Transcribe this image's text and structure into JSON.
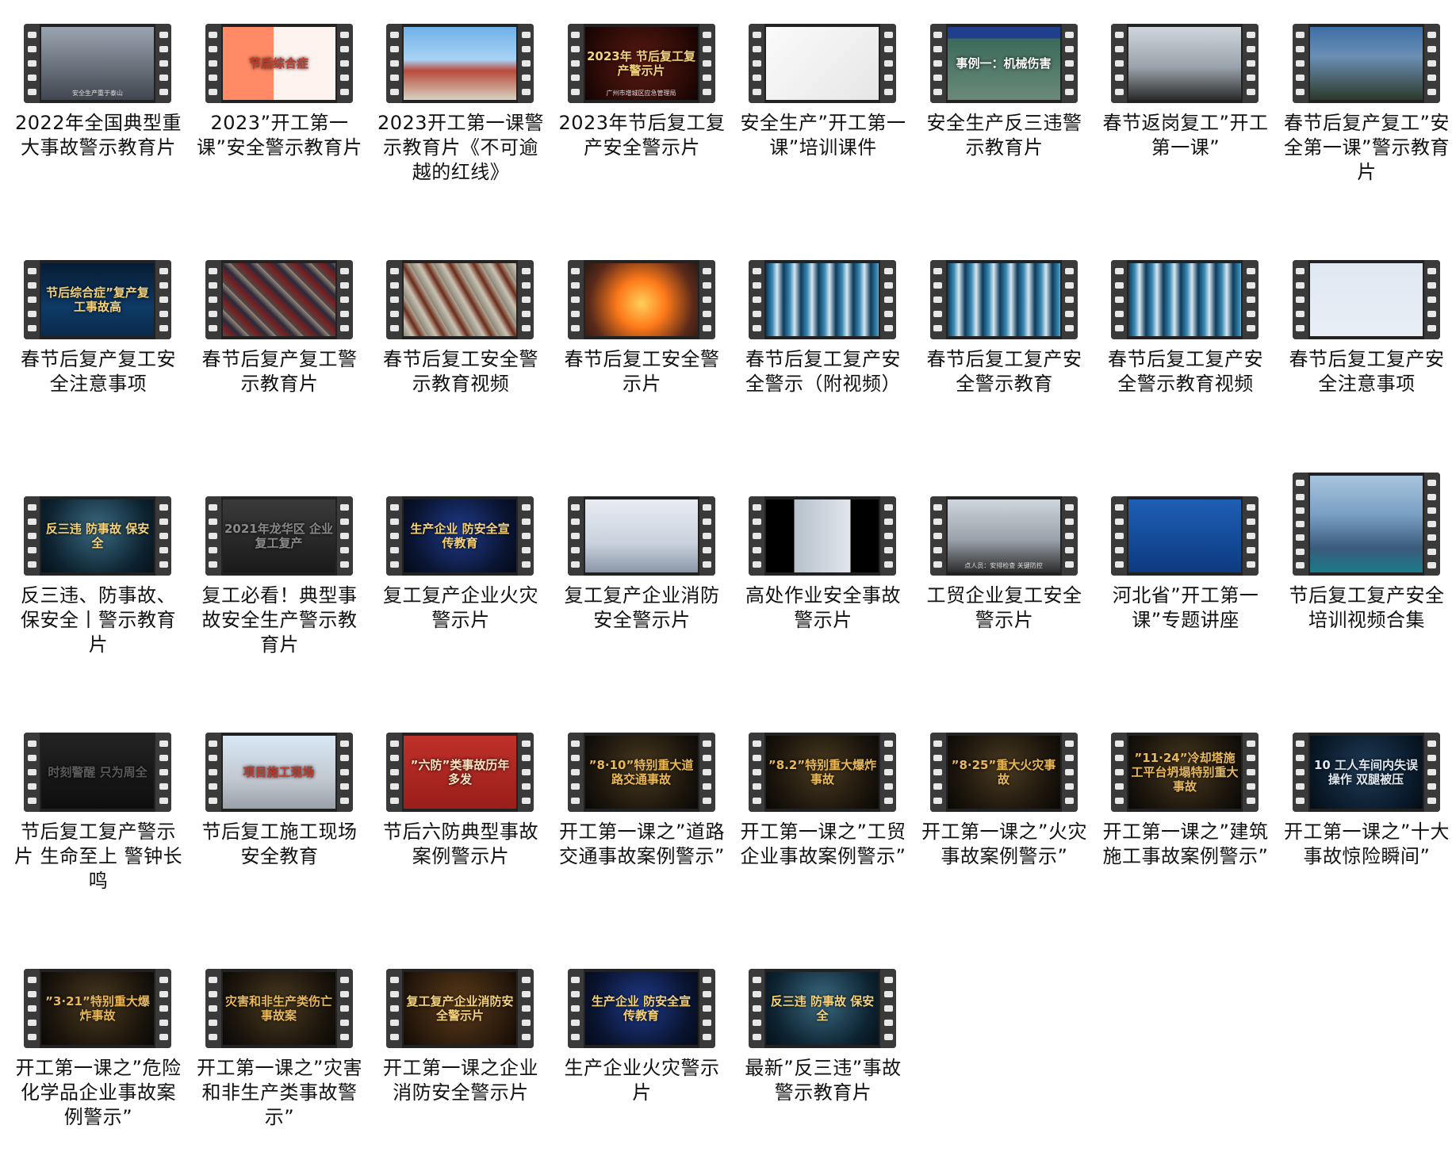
{
  "videos": [
    {
      "title": "2022年全国典型重大事故警示教育片",
      "thumb_text": "",
      "thumb_sub": "安全生产重于泰山",
      "bg": "linear-gradient(180deg,#9aa4b0 0%,#6d7680 50%,#404650 100%)",
      "fg": "#ffffff",
      "tall": false
    },
    {
      "title": "2023”开工第一课”安全警示教育片",
      "thumb_text": "节后综合症",
      "thumb_sub": "",
      "bg": "linear-gradient(90deg,#ff8a65 0%,#ff8a65 45%,#fff3ef 45%,#fff3ef 100%)",
      "fg": "#c0392b",
      "tall": false
    },
    {
      "title": "2023开工第一课警示教育片《不可逾越的红线》",
      "thumb_text": "",
      "thumb_sub": "",
      "bg": "linear-gradient(180deg,#6fb0e8 0%,#a9d3f5 45%,#b84a3a 60%,#d9d2c2 100%)",
      "fg": "#ffffff",
      "tall": false
    },
    {
      "title": "2023年节后复工复产安全警示片",
      "thumb_text": "2023年 节后复工复产警示片",
      "thumb_sub": "广州市增城区应急管理局",
      "bg": "radial-gradient(circle at 50% 50%,#5a1a12 0%,#2a0a06 70%,#120303 100%)",
      "fg": "#f5d27a",
      "tall": false
    },
    {
      "title": "安全生产”开工第一课”培训课件",
      "thumb_text": "",
      "thumb_sub": "",
      "bg": "linear-gradient(135deg,#fbfbfb 0%,#e6e6e6 100%)",
      "fg": "#333333",
      "tall": false
    },
    {
      "title": "安全生产反三违警示教育片",
      "thumb_text": "事例一：机械伤害",
      "thumb_sub": "",
      "bg": "linear-gradient(180deg,#1f3f8c 0%,#1f3f8c 16%,#3a6a5a 16%,#6b8a7a 100%)",
      "fg": "#ffffff",
      "tall": false
    },
    {
      "title": "春节返岗复工”开工第一课”",
      "thumb_text": "",
      "thumb_sub": "",
      "bg": "linear-gradient(180deg,#cfd6dc 0%,#9aa3ab 55%,#2b2b2b 100%)",
      "fg": "#222222",
      "tall": false
    },
    {
      "title": "春节后复产复工”安全第一课”警示教育片",
      "thumb_text": "",
      "thumb_sub": "",
      "bg": "linear-gradient(180deg,#3c6ea5 0%,#6b8fb5 40%,#2c3a2a 100%)",
      "fg": "#ffffff",
      "tall": false
    },
    {
      "title": "春节后复产复工安全注意事项",
      "thumb_text": "节后综合症”复产复工事故高",
      "thumb_sub": "",
      "bg": "linear-gradient(180deg,#071b33 0%,#0d3a66 60%,#0a2a4a 100%)",
      "fg": "#f5d27a",
      "tall": false
    },
    {
      "title": "春节后复产复工警示教育片",
      "thumb_text": "",
      "thumb_sub": "",
      "bg": "repeating-linear-gradient(45deg,#4a4a4a 0px,#7a2020 8px,#2a2a3a 16px,#9a8a7a 24px)",
      "fg": "#ffffff",
      "tall": false
    },
    {
      "title": "春节后复工安全警示教育视频",
      "thumb_text": "",
      "thumb_sub": "",
      "bg": "repeating-linear-gradient(60deg,#8a8478 0px,#c9c2b2 10px,#6a2a1a 18px,#b5aa96 26px)",
      "fg": "#ffffff",
      "tall": false
    },
    {
      "title": "春节后复工安全警示片",
      "thumb_text": "",
      "thumb_sub": "",
      "bg": "radial-gradient(circle at 50% 55%,#ffd15a 0%,#ff7a1a 35%,#5a2a1a 75%,#2a1a12 100%)",
      "fg": "#ffffff",
      "tall": false
    },
    {
      "title": "春节后复工复产安全警示（附视频）",
      "thumb_text": "",
      "thumb_sub": "",
      "bg": "repeating-linear-gradient(90deg,#0e3a5a 0px,#3a8ab5 8px,#d8e8f0 14px,#0e3a5a 22px)",
      "fg": "#ffffff",
      "tall": false
    },
    {
      "title": "春节后复工复产安全警示教育",
      "thumb_text": "",
      "thumb_sub": "",
      "bg": "repeating-linear-gradient(90deg,#0e3a5a 0px,#3a8ab5 8px,#d8e8f0 14px,#0e3a5a 22px)",
      "fg": "#ffffff",
      "tall": false
    },
    {
      "title": "春节后复工复产安全警示教育视频",
      "thumb_text": "",
      "thumb_sub": "",
      "bg": "repeating-linear-gradient(90deg,#0e3a5a 0px,#3a8ab5 8px,#d8e8f0 14px,#0e3a5a 22px)",
      "fg": "#ffffff",
      "tall": false
    },
    {
      "title": "春节后复工复产安全注意事项",
      "thumb_text": "",
      "thumb_sub": "",
      "bg": "linear-gradient(180deg,#dfe8f2 0%,#e9eef5 100%)",
      "fg": "#1f3f8c",
      "tall": false
    },
    {
      "title": "反三违、防事故、保安全丨警示教育片",
      "thumb_text": "反三违 防事故 保安全",
      "thumb_sub": "",
      "bg": "radial-gradient(circle at 50% 40%,#3a6a80 0%,#0d2230 70%,#06121a 100%)",
      "fg": "#f5d27a",
      "tall": false
    },
    {
      "title": "复工必看！典型事故安全生产警示教育片",
      "thumb_text": "2021年龙华区 企业复工复产",
      "thumb_sub": "",
      "bg": "linear-gradient(180deg,#3a3a3a 0%,#1a1a1a 100%)",
      "fg": "#8a8a8a",
      "tall": false
    },
    {
      "title": "复工复产企业火灾警示片",
      "thumb_text": "生产企业 防安全宣传教育",
      "thumb_sub": "",
      "bg": "radial-gradient(circle at 50% 45%,#1e3a8a 0%,#0a1430 70%,#050a1a 100%)",
      "fg": "#f5d27a",
      "tall": false
    },
    {
      "title": "复工复产企业消防安全警示片",
      "thumb_text": "",
      "thumb_sub": "",
      "bg": "linear-gradient(180deg,#e8ecf2 0%,#c9d2de 60%,#8a96a8 100%)",
      "fg": "#333333",
      "tall": false
    },
    {
      "title": "高处作业安全事故警示片",
      "thumb_text": "",
      "thumb_sub": "",
      "bg": "linear-gradient(90deg,#000 0%,#000 25%,#b8c2cc 25%,#e0e6ec 75%,#000 75%,#000 100%)",
      "fg": "#ffffff",
      "tall": false
    },
    {
      "title": "工贸企业复工安全警示片",
      "thumb_text": "",
      "thumb_sub": "点人员：安排检查 关键防控",
      "bg": "linear-gradient(180deg,#cfd6dc 0%,#9aa3ab 55%,#2b2b2b 100%)",
      "fg": "#222222",
      "tall": false
    },
    {
      "title": "河北省”开工第一课”专题讲座",
      "thumb_text": "",
      "thumb_sub": "",
      "bg": "linear-gradient(180deg,#1e5fb5 0%,#0d3a80 100%)",
      "fg": "#ffffff",
      "tall": false
    },
    {
      "title": "节后复工复产安全培训视频合集",
      "thumb_text": "",
      "thumb_sub": "",
      "bg": "linear-gradient(180deg,#a8c4de 0%,#7aa0c4 40%,#3a5a7a 75%,#1a7a8a 100%)",
      "fg": "#ffffff",
      "tall": true
    },
    {
      "title": "节后复工复产警示片 生命至上 警钟长鸣",
      "thumb_text": "时刻警醒 只为周全",
      "thumb_sub": "",
      "bg": "linear-gradient(180deg,#222 0%,#0e0e0e 100%)",
      "fg": "#5a5a5a",
      "tall": false
    },
    {
      "title": "节后复工施工现场安全教育",
      "thumb_text": "项目施工现场",
      "thumb_sub": "",
      "bg": "linear-gradient(180deg,#d8e8f5 0%,#c2c8d0 60%,#9aa0a8 100%)",
      "fg": "#c0392b",
      "tall": false
    },
    {
      "title": "节后六防典型事故案例警示片",
      "thumb_text": "”六防”类事故历年多发",
      "thumb_sub": "",
      "bg": "linear-gradient(180deg,#c0302a 0%,#9a1e1a 100%)",
      "fg": "#fbe3c0",
      "tall": false
    },
    {
      "title": "开工第一课之”道路交通事故案例警示”",
      "thumb_text": "”8·10”特别重大道路交通事故",
      "thumb_sub": "",
      "bg": "radial-gradient(circle at 50% 45%,#4a3a20 0%,#1a140c 70%,#0a0805 100%)",
      "fg": "#e8b85a",
      "tall": false
    },
    {
      "title": "开工第一课之”工贸企业事故案例警示”",
      "thumb_text": "”8.2”特别重大爆炸事故",
      "thumb_sub": "",
      "bg": "radial-gradient(circle at 50% 45%,#4a3a20 0%,#1a140c 70%,#0a0805 100%)",
      "fg": "#e8b85a",
      "tall": false
    },
    {
      "title": "开工第一课之”火灾事故案例警示”",
      "thumb_text": "”8·25”重大火灾事故",
      "thumb_sub": "",
      "bg": "radial-gradient(circle at 50% 45%,#4a3a20 0%,#1a140c 70%,#0a0805 100%)",
      "fg": "#e8b85a",
      "tall": false
    },
    {
      "title": "开工第一课之”建筑施工事故案例警示”",
      "thumb_text": "”11·24”冷却塔施工平台坍塌特别重大事故",
      "thumb_sub": "",
      "bg": "radial-gradient(circle at 50% 45%,#4a3a20 0%,#1a140c 70%,#0a0805 100%)",
      "fg": "#e8b85a",
      "tall": false
    },
    {
      "title": "开工第一课之”十大事故惊险瞬间”",
      "thumb_text": "10 工人车间内失误操作 双腿被压",
      "thumb_sub": "",
      "bg": "radial-gradient(circle at 50% 45%,#1e3a55 0%,#0a1a2a 70%,#050d15 100%)",
      "fg": "#dfe8f0",
      "tall": false
    },
    {
      "title": "开工第一课之”危险化学品企业事故案例警示”",
      "thumb_text": "”3·21”特别重大爆炸事故",
      "thumb_sub": "",
      "bg": "radial-gradient(circle at 50% 45%,#4a3a20 0%,#1a140c 70%,#0a0805 100%)",
      "fg": "#e8b85a",
      "tall": false
    },
    {
      "title": "开工第一课之”灾害和非生产类事故警示”",
      "thumb_text": "灾害和非生产类伤亡事故案",
      "thumb_sub": "",
      "bg": "radial-gradient(circle at 50% 45%,#4a3a20 0%,#1a140c 70%,#0a0805 100%)",
      "fg": "#e8b85a",
      "tall": false
    },
    {
      "title": "开工第一课之企业消防安全警示片",
      "thumb_text": "复工复产企业消防安全警示片",
      "thumb_sub": "",
      "bg": "radial-gradient(circle at 50% 45%,#5a3a1a 0%,#2a1a0c 70%,#120a05 100%)",
      "fg": "#f5d27a",
      "tall": false
    },
    {
      "title": "生产企业火灾警示片",
      "thumb_text": "生产企业 防安全宣传教育",
      "thumb_sub": "",
      "bg": "radial-gradient(circle at 50% 45%,#1e3a8a 0%,#0a1430 70%,#050a1a 100%)",
      "fg": "#f5d27a",
      "tall": false
    },
    {
      "title": "最新”反三违”事故警示教育片",
      "thumb_text": "反三违 防事故 保安全",
      "thumb_sub": "",
      "bg": "radial-gradient(circle at 50% 40%,#3a6a80 0%,#0d2230 70%,#06121a 100%)",
      "fg": "#f5d27a",
      "tall": false
    }
  ]
}
